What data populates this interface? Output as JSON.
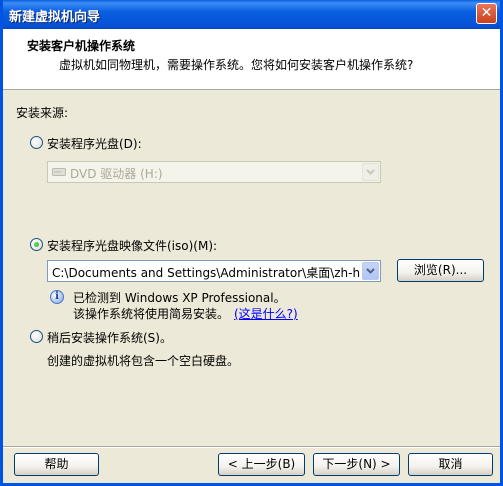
{
  "window": {
    "title": "新建虚拟机向导",
    "close_label": "✕"
  },
  "header": {
    "title": "安装客户机操作系统",
    "subtitle": "虚拟机如同物理机，需要操作系统。您将如何安装客户机操作系统?"
  },
  "source_label": "安装来源:",
  "disc_option": {
    "label": "安装程序光盘(D):",
    "selected": false
  },
  "disc_drive": {
    "value": "DVD 驱动器 (H:)",
    "disabled": true
  },
  "iso_option": {
    "label": "安装程序光盘映像文件(iso)(M):",
    "selected": true
  },
  "iso_path": {
    "value": "C:\\Documents and Settings\\Administrator\\桌面\\zh-hans_"
  },
  "browse_button": "浏览(R)...",
  "detect": {
    "line1": "已检测到 Windows XP Professional。",
    "line2": "该操作系统将使用简易安装。",
    "link": "(这是什么?)"
  },
  "later_option": {
    "label": "稍后安装操作系统(S)。",
    "selected": false
  },
  "later_note": "创建的虚拟机将包含一个空白硬盘。",
  "footer": {
    "help": "帮助",
    "back": "< 上一步(B)",
    "next": "下一步(N) >",
    "cancel": "取消"
  }
}
